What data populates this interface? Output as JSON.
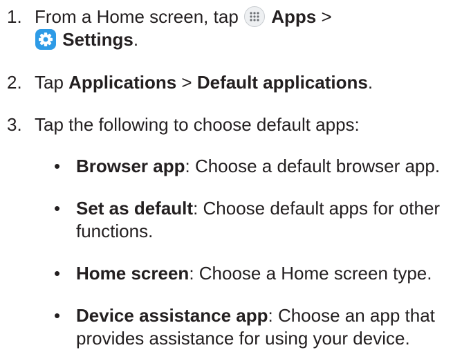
{
  "steps": [
    {
      "number": "1.",
      "pre": "From a Home screen, tap",
      "apps_label": "Apps",
      "sep": ">",
      "settings_label": "Settings",
      "end": "."
    },
    {
      "number": "2.",
      "pre": "Tap",
      "item1": "Applications",
      "sep": ">",
      "item2": "Default applications",
      "end": "."
    },
    {
      "number": "3.",
      "text": "Tap the following to choose default apps:"
    }
  ],
  "bullets": [
    {
      "marker": "•",
      "term": "Browser app",
      "desc": ": Choose a default browser app."
    },
    {
      "marker": "•",
      "term": "Set as default",
      "desc": ": Choose default apps for other functions."
    },
    {
      "marker": "•",
      "term": "Home screen",
      "desc": ": Choose a Home screen type."
    },
    {
      "marker": "•",
      "term": "Device assistance app",
      "desc": ": Choose an app that provides assistance for using your device."
    }
  ],
  "icons": {
    "apps": "apps-grid-icon",
    "settings": "gear-icon"
  },
  "colors": {
    "text": "#231f20",
    "settings_icon_bg": "#2e9be6",
    "apps_icon_bg": "#eef0f2"
  }
}
